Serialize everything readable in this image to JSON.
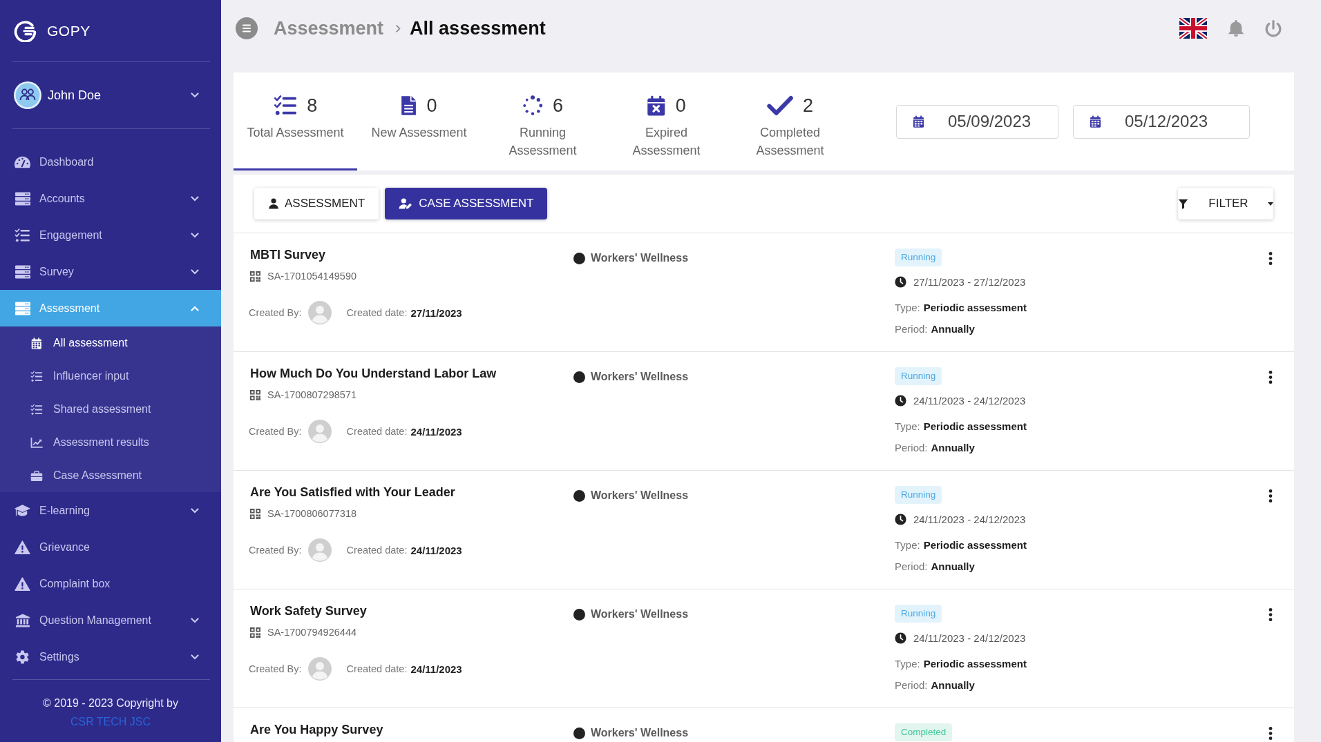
{
  "brand": {
    "name": "GOPY"
  },
  "user": {
    "name": "John Doe",
    "expanded": false
  },
  "sidebar": {
    "items": [
      {
        "label": "Dashboard",
        "kind": "link",
        "selected": false
      },
      {
        "label": "Accounts",
        "kind": "group",
        "expanded": false,
        "selected": false
      },
      {
        "label": "Engagement",
        "kind": "group",
        "expanded": false,
        "selected": false
      },
      {
        "label": "Survey",
        "kind": "group",
        "expanded": false,
        "selected": false
      },
      {
        "label": "Assessment",
        "kind": "group",
        "expanded": true,
        "selected": true,
        "children": [
          {
            "label": "All assessment",
            "selected": true
          },
          {
            "label": "Influencer input",
            "selected": false
          },
          {
            "label": "Shared assessment",
            "selected": false
          },
          {
            "label": "Assessment results",
            "selected": false
          },
          {
            "label": "Case Assessment",
            "selected": false
          }
        ]
      },
      {
        "label": "E-learning",
        "kind": "group",
        "expanded": false,
        "selected": false
      },
      {
        "label": "Grievance",
        "kind": "link",
        "selected": false
      },
      {
        "label": "Complaint box",
        "kind": "link",
        "selected": false
      },
      {
        "label": "Question Management",
        "kind": "group",
        "expanded": false,
        "selected": false
      },
      {
        "label": "Settings",
        "kind": "group",
        "expanded": false,
        "selected": false
      }
    ]
  },
  "footer": {
    "copyright": "© 2019 - 2023 Copyright by",
    "link": "CSR TECH JSC"
  },
  "breadcrumb": [
    "Assessment",
    "All assessment"
  ],
  "stats": [
    {
      "count": "8",
      "label": "Total Assessment",
      "selected": true
    },
    {
      "count": "0",
      "label": "New Assessment",
      "selected": false
    },
    {
      "count": "6",
      "label": "Running Assessment",
      "selected": false
    },
    {
      "count": "0",
      "label": "Expired Assessment",
      "selected": false
    },
    {
      "count": "2",
      "label": "Completed Assessment",
      "selected": false
    }
  ],
  "date_filters": [
    {
      "value": "05/09/2023"
    },
    {
      "value": "05/12/2023"
    }
  ],
  "view_tabs": [
    {
      "label": "ASSESSMENT",
      "selected": false
    },
    {
      "label": "CASE ASSESSMENT",
      "selected": true
    }
  ],
  "filter_button": {
    "label": "FILTER"
  },
  "assessments": [
    {
      "title": "MBTI Survey",
      "code": "SA-1701054149590",
      "created_by_label": "Created By:",
      "created_date_label": "Created date:",
      "created_date": "27/11/2023",
      "category": "Workers' Wellness",
      "status": {
        "label": "Running",
        "kind": "running"
      },
      "date_range": "27/11/2023 - 27/12/2023",
      "type_label": "Type:",
      "type": "Periodic assessment",
      "period_label": "Period:",
      "period": "Annually"
    },
    {
      "title": "How Much Do You Understand Labor Law",
      "code": "SA-1700807298571",
      "created_by_label": "Created By:",
      "created_date_label": "Created date:",
      "created_date": "24/11/2023",
      "category": "Workers' Wellness",
      "status": {
        "label": "Running",
        "kind": "running"
      },
      "date_range": "24/11/2023 - 24/12/2023",
      "type_label": "Type:",
      "type": "Periodic assessment",
      "period_label": "Period:",
      "period": "Annually"
    },
    {
      "title": "Are You Satisfied with Your Leader",
      "code": "SA-1700806077318",
      "created_by_label": "Created By:",
      "created_date_label": "Created date:",
      "created_date": "24/11/2023",
      "category": "Workers' Wellness",
      "status": {
        "label": "Running",
        "kind": "running"
      },
      "date_range": "24/11/2023 - 24/12/2023",
      "type_label": "Type:",
      "type": "Periodic assessment",
      "period_label": "Period:",
      "period": "Annually"
    },
    {
      "title": "Work Safety Survey",
      "code": "SA-1700794926444",
      "created_by_label": "Created By:",
      "created_date_label": "Created date:",
      "created_date": "24/11/2023",
      "category": "Workers' Wellness",
      "status": {
        "label": "Running",
        "kind": "running"
      },
      "date_range": "24/11/2023 - 24/12/2023",
      "type_label": "Type:",
      "type": "Periodic assessment",
      "period_label": "Period:",
      "period": "Annually"
    },
    {
      "title": "Are You Happy Survey",
      "category": "Workers' Wellness",
      "status": {
        "label": "Completed",
        "kind": "completed"
      }
    }
  ]
}
